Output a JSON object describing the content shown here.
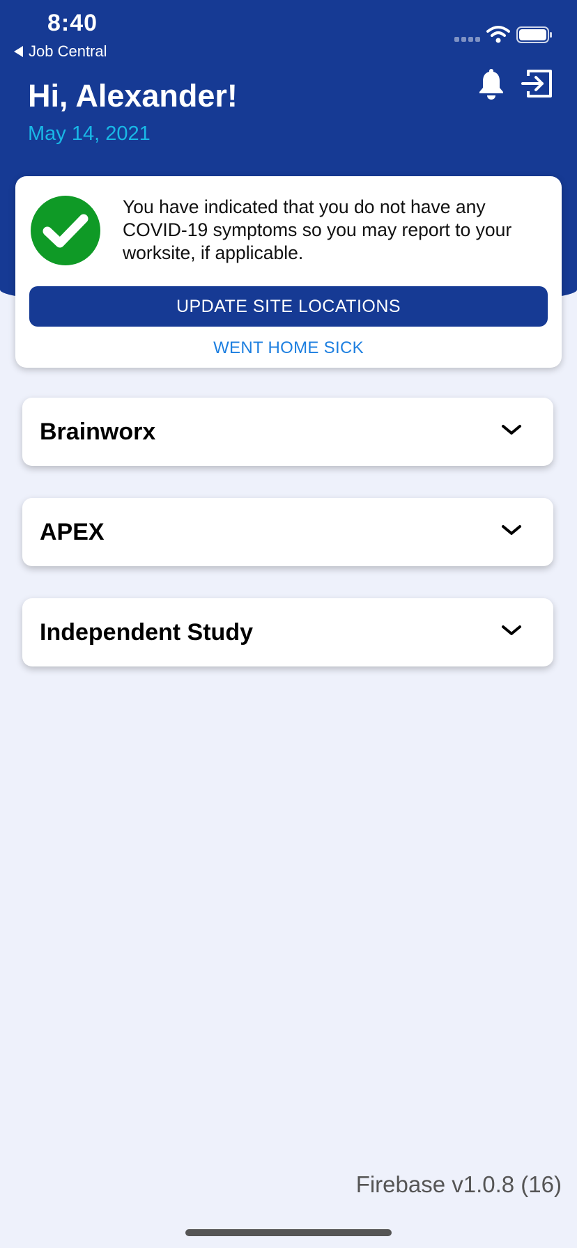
{
  "status_bar": {
    "time": "8:40",
    "back_label": "Job Central"
  },
  "header": {
    "greeting": "Hi, Alexander!",
    "date": "May 14, 2021",
    "icons": [
      "bell-icon",
      "logout-icon"
    ]
  },
  "status_card": {
    "icon": "check-icon",
    "message": "You have indicated that you do not have any COVID-19 symptoms so you may report to your worksite, if applicable.",
    "update_button_label": "UPDATE SITE LOCATIONS",
    "sick_link_label": "WENT HOME SICK"
  },
  "sites": [
    {
      "label": "Brainworx"
    },
    {
      "label": "APEX"
    },
    {
      "label": "Independent Study"
    }
  ],
  "footer": {
    "version": "Firebase v1.0.8 (16)"
  },
  "colors": {
    "primary": "#163a94",
    "accent_date": "#19b8e6",
    "link": "#1d7fe0",
    "success": "#0f9a26",
    "background": "#eef1fb"
  }
}
